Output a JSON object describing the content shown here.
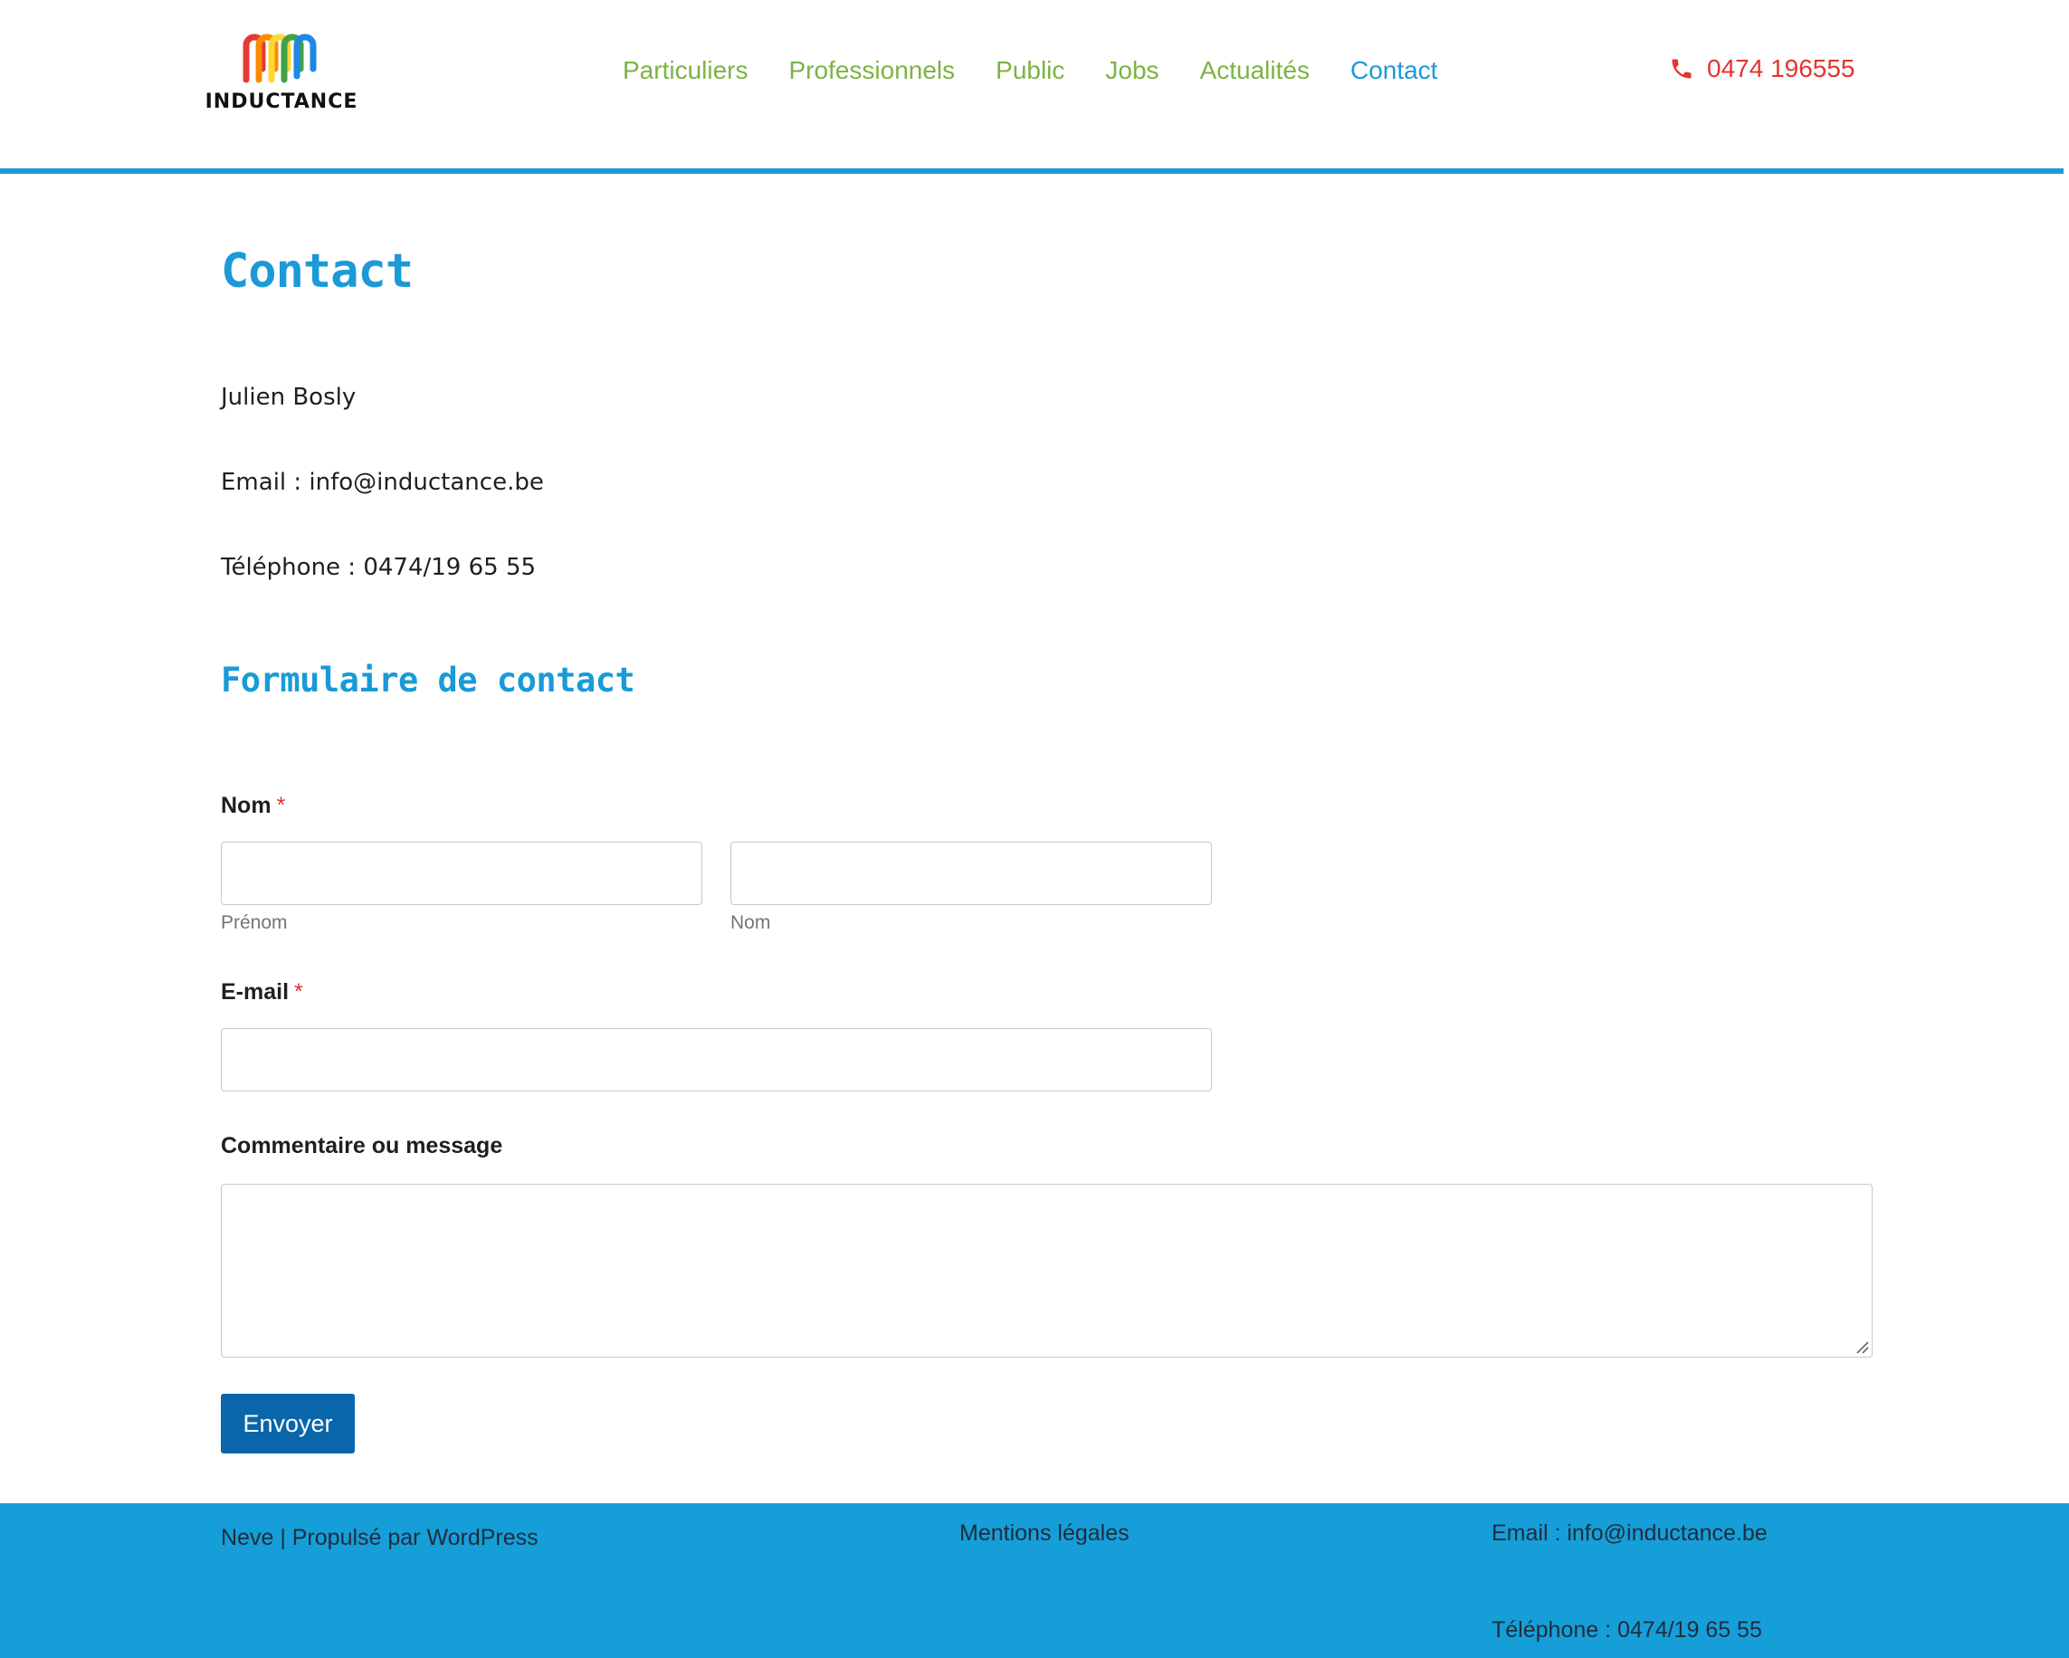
{
  "header": {
    "logo_text": "INDUCTANCE",
    "logo_icon": "rainbow-coil-logo",
    "nav": [
      {
        "label": "Particuliers",
        "active": false
      },
      {
        "label": "Professionnels",
        "active": false
      },
      {
        "label": "Public",
        "active": false
      },
      {
        "label": "Jobs",
        "active": false
      },
      {
        "label": "Actualités",
        "active": false
      },
      {
        "label": "Contact",
        "active": true
      }
    ],
    "phone": "0474 196555",
    "phone_icon": "phone-icon"
  },
  "main": {
    "page_title": "Contact",
    "contact_name": "Julien Bosly",
    "contact_email": "Email : info@inductance.be",
    "contact_phone": "Téléphone : 0474/19 65 55",
    "form_title": "Formulaire de contact",
    "form": {
      "name_label": "Nom",
      "required_marker": "*",
      "first_name_value": "",
      "first_name_sublabel": "Prénom",
      "last_name_value": "",
      "last_name_sublabel": "Nom",
      "email_label": "E-mail",
      "email_value": "",
      "comment_label": "Commentaire ou message",
      "comment_value": "",
      "submit_label": "Envoyer"
    }
  },
  "footer": {
    "credit_theme": "Neve",
    "credit_separator": " | Propulsé par ",
    "credit_platform": "WordPress",
    "legal_link": "Mentions légales",
    "email": "Email : info@inductance.be",
    "phone": "Téléphone : 0474/19 65 55"
  },
  "colors": {
    "accent_blue": "#1a9ad6",
    "nav_green": "#7cb342",
    "phone_red": "#e3342f",
    "button_blue": "#0a66aa",
    "footer_blue": "#169ed9",
    "required_red": "#d63638"
  }
}
